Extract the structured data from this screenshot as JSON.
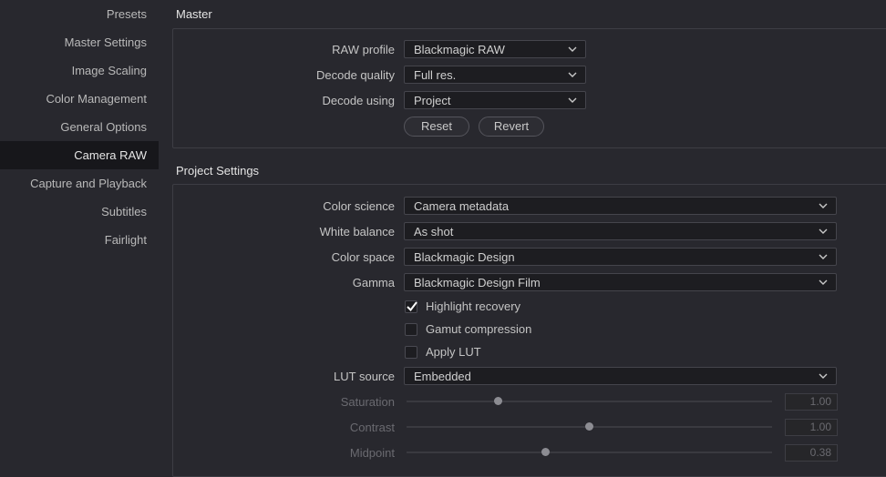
{
  "sidebar": {
    "items": [
      {
        "label": "Presets",
        "active": false
      },
      {
        "label": "Master Settings",
        "active": false
      },
      {
        "label": "Image Scaling",
        "active": false
      },
      {
        "label": "Color Management",
        "active": false
      },
      {
        "label": "General Options",
        "active": false
      },
      {
        "label": "Camera RAW",
        "active": true
      },
      {
        "label": "Capture and Playback",
        "active": false
      },
      {
        "label": "Subtitles",
        "active": false
      },
      {
        "label": "Fairlight",
        "active": false
      }
    ]
  },
  "master": {
    "title": "Master",
    "raw_profile": {
      "label": "RAW profile",
      "value": "Blackmagic RAW"
    },
    "decode_quality": {
      "label": "Decode quality",
      "value": "Full res."
    },
    "decode_using": {
      "label": "Decode using",
      "value": "Project"
    },
    "reset_label": "Reset",
    "revert_label": "Revert"
  },
  "project": {
    "title": "Project Settings",
    "color_science": {
      "label": "Color science",
      "value": "Camera metadata"
    },
    "white_balance": {
      "label": "White balance",
      "value": "As shot"
    },
    "color_space": {
      "label": "Color space",
      "value": "Blackmagic Design"
    },
    "gamma": {
      "label": "Gamma",
      "value": "Blackmagic Design Film"
    },
    "highlight_recovery": {
      "label": "Highlight recovery",
      "checked": true
    },
    "gamut_compression": {
      "label": "Gamut compression",
      "checked": false
    },
    "apply_lut": {
      "label": "Apply LUT",
      "checked": false
    },
    "lut_source": {
      "label": "LUT source",
      "value": "Embedded"
    },
    "saturation": {
      "label": "Saturation",
      "value": "1.00",
      "level": 0.25
    },
    "contrast": {
      "label": "Contrast",
      "value": "1.00",
      "level": 0.5
    },
    "midpoint": {
      "label": "Midpoint",
      "value": "0.38",
      "level": 0.38
    }
  },
  "colors": {
    "accent_active_bg": "#17171b",
    "panel_bg": "#28282e"
  }
}
